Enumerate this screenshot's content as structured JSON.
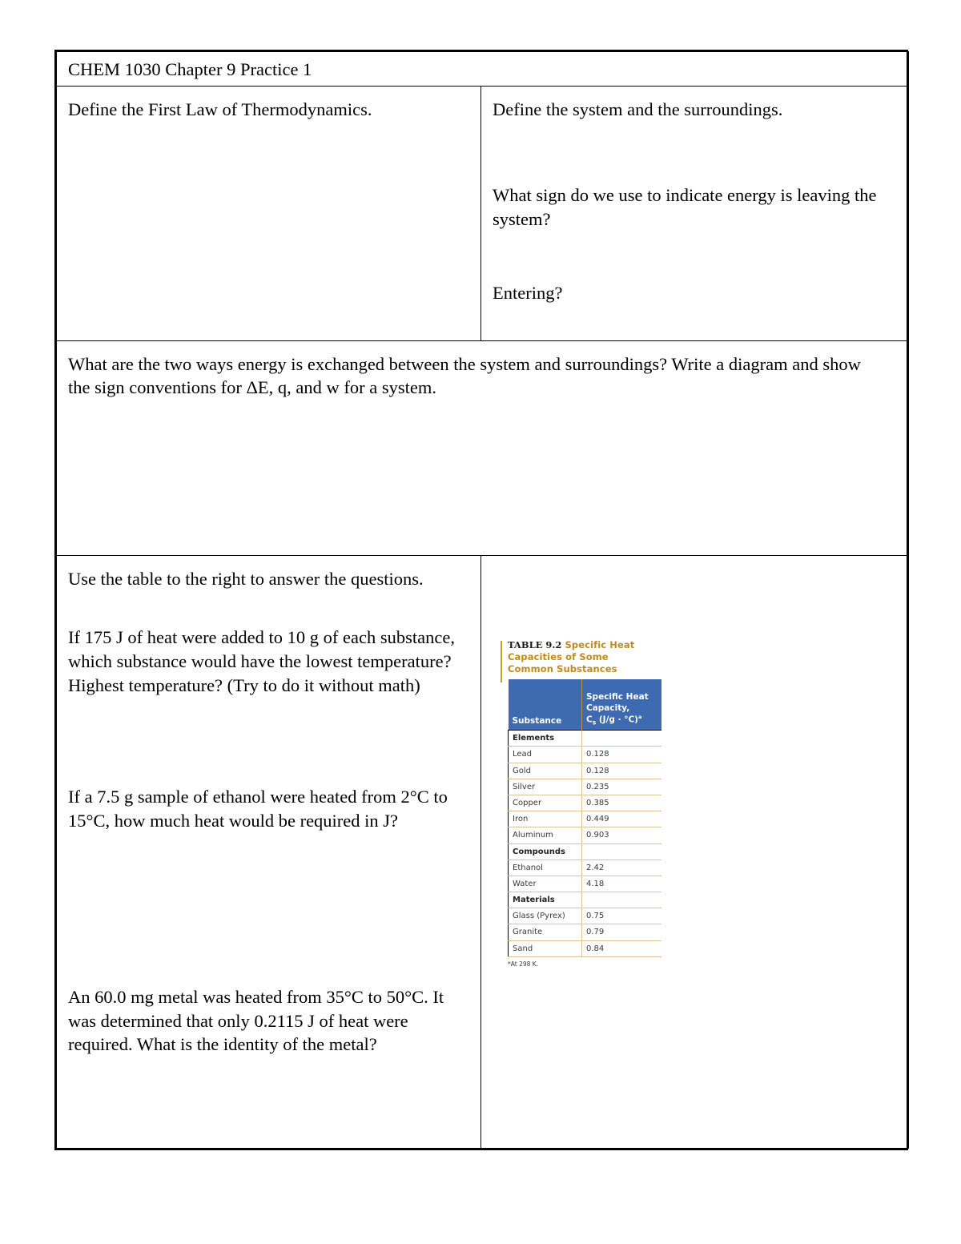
{
  "document": {
    "title": "CHEM 1030 Chapter 9 Practice 1"
  },
  "questions": {
    "q1_first_law": "Define the First Law of Thermodynamics.",
    "q2_system_surroundings": "Define the system and the surroundings.",
    "q3_sign_leaving": "What sign do we use to indicate energy is leaving the system?",
    "q4_entering": "Entering?",
    "q5_exchange_line1": "What are the two ways energy is exchanged between the system and surroundings? Write a diagram and show",
    "q5_exchange_line2": "the sign conventions for ΔE, q, and w for a system.",
    "q6_use_table": "Use the table to the right to answer the questions.",
    "q7_175J": "If 175 J of heat were added to 10 g of each substance, which substance would have the lowest temperature? Highest temperature? (Try to do it without math)",
    "q8_ethanol": "If a 7.5 g sample of ethanol were heated from 2°C to 15°C, how much heat would be required in J?",
    "q9_metal": "An 60.0 mg metal was heated from 35°C to 50°C. It was determined that only 0.2115 J of heat were required.  What is the identity of the metal?"
  },
  "figure": {
    "label": "TABLE 9.2",
    "title": "Specific Heat Capacities of Some Common Substances",
    "title_line1": "Specific Heat",
    "title_line2": "Capacities of Some",
    "title_line3": "Common Substances",
    "columns": {
      "substance": "Substance",
      "capacity_line1": "Specific Heat",
      "capacity_line2": "Capacity,",
      "capacity_symbol": "C",
      "capacity_symbol_sub": "s",
      "capacity_units": " (J/g · °C)",
      "capacity_units_sup": "a"
    },
    "footnote": "*At 298 K.",
    "header_color": "#3d6ab0",
    "rule_color": "#d9c39b",
    "title_color": "#c08a1e",
    "rows": [
      {
        "name": "Elements",
        "value": "",
        "group": true
      },
      {
        "name": "Lead",
        "value": "0.128",
        "group": false
      },
      {
        "name": "Gold",
        "value": "0.128",
        "group": false
      },
      {
        "name": "Silver",
        "value": "0.235",
        "group": false
      },
      {
        "name": "Copper",
        "value": "0.385",
        "group": false
      },
      {
        "name": "Iron",
        "value": "0.449",
        "group": false
      },
      {
        "name": "Aluminum",
        "value": "0.903",
        "group": false
      },
      {
        "name": "Compounds",
        "value": "",
        "group": true
      },
      {
        "name": "Ethanol",
        "value": "2.42",
        "group": false
      },
      {
        "name": "Water",
        "value": "4.18",
        "group": false
      },
      {
        "name": "Materials",
        "value": "",
        "group": true
      },
      {
        "name": "Glass (Pyrex)",
        "value": "0.75",
        "group": false
      },
      {
        "name": "Granite",
        "value": "0.79",
        "group": false
      },
      {
        "name": "Sand",
        "value": "0.84",
        "group": false
      }
    ]
  }
}
